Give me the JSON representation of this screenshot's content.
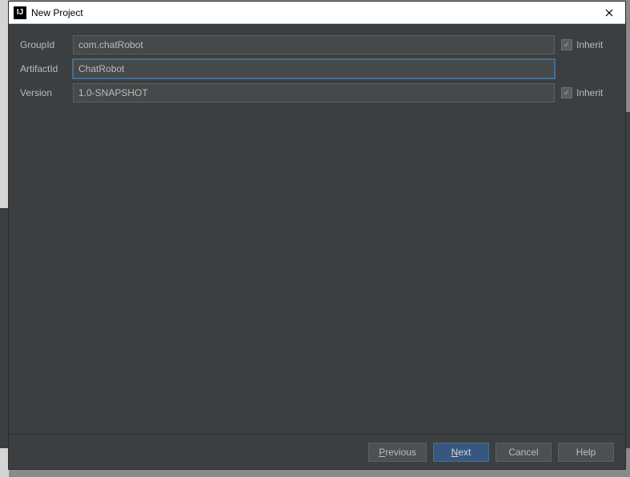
{
  "window": {
    "title": "New Project"
  },
  "form": {
    "groupId": {
      "label": "GroupId",
      "value": "com.chatRobot",
      "inherit_label": "Inherit",
      "inherit_checked": true
    },
    "artifactId": {
      "label": "ArtifactId",
      "value": "ChatRobot"
    },
    "version": {
      "label": "Version",
      "value": "1.0-SNAPSHOT",
      "inherit_label": "Inherit",
      "inherit_checked": true
    }
  },
  "buttons": {
    "previous": "Previous",
    "next": "Next",
    "cancel": "Cancel",
    "help": "Help"
  }
}
